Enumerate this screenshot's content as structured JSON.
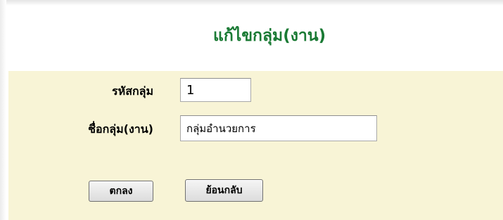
{
  "form": {
    "title": "แก้ไขกลุ่ม(งาน)",
    "group_code_label": "รหัสกลุ่ม",
    "group_code_value": "1",
    "group_name_label": "ชื่อกลุ่ม(งาน)",
    "group_name_value": "กลุ่มอำนวยการ",
    "ok_label": "ตกลง",
    "back_label": "ย้อนกลับ"
  },
  "colors": {
    "title": "#1a7a34",
    "panel_background": "#f8f4d6"
  }
}
